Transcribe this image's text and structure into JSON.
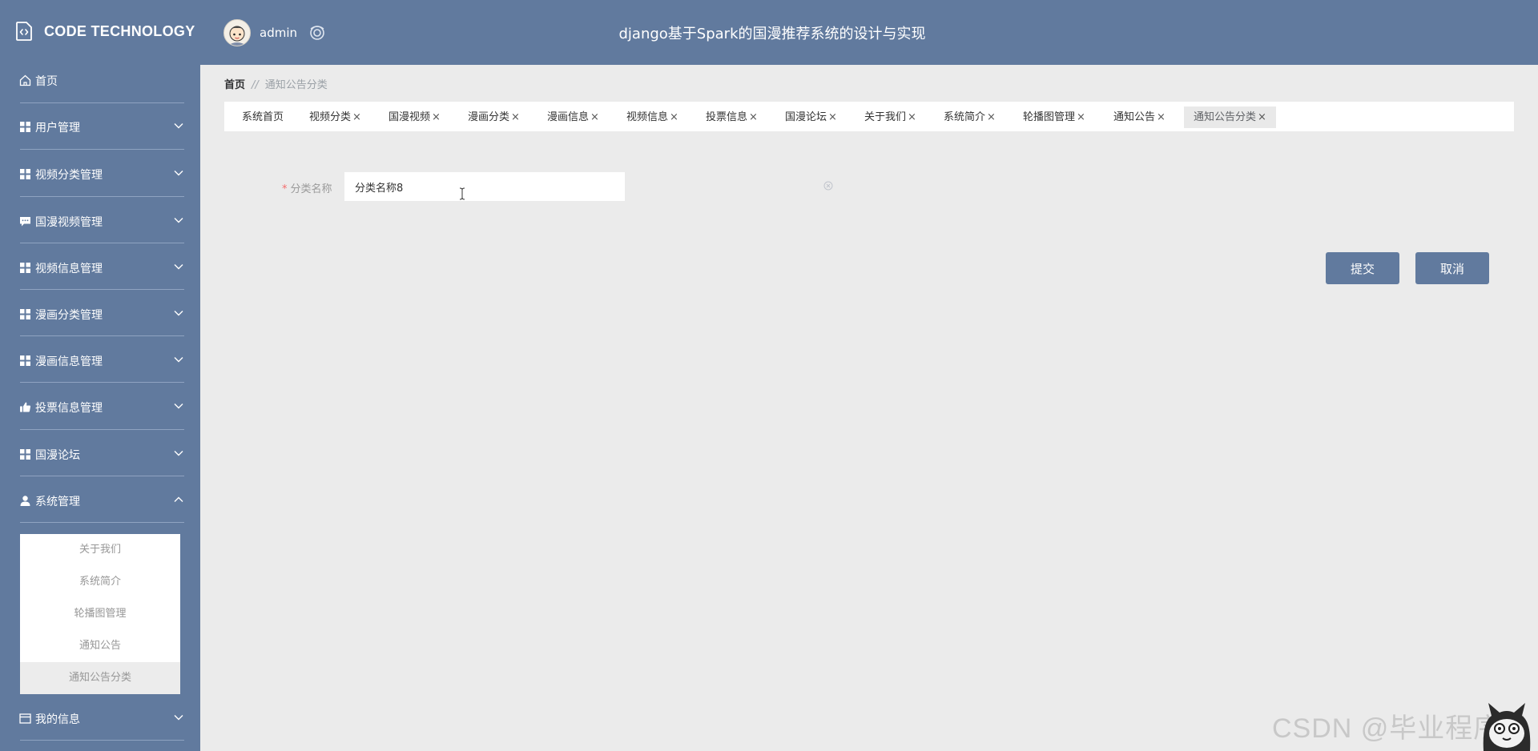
{
  "header": {
    "logo_text": "CODE TECHNOLOGY",
    "username": "admin",
    "app_title": "django基于Spark的国漫推荐系统的设计与实现"
  },
  "sidebar": {
    "items": [
      {
        "label": "首页",
        "icon": "home-icon"
      },
      {
        "label": "用户管理",
        "icon": "grid-icon"
      },
      {
        "label": "视频分类管理",
        "icon": "grid-icon"
      },
      {
        "label": "国漫视频管理",
        "icon": "chat-icon"
      },
      {
        "label": "视频信息管理",
        "icon": "grid-icon"
      },
      {
        "label": "漫画分类管理",
        "icon": "grid-icon"
      },
      {
        "label": "漫画信息管理",
        "icon": "grid-icon"
      },
      {
        "label": "投票信息管理",
        "icon": "thumb-up-icon"
      },
      {
        "label": "国漫论坛",
        "icon": "grid-icon"
      },
      {
        "label": "系统管理",
        "icon": "user-icon"
      },
      {
        "label": "我的信息",
        "icon": "card-icon"
      }
    ],
    "submenu": [
      "关于我们",
      "系统简介",
      "轮播图管理",
      "通知公告",
      "通知公告分类"
    ],
    "active_sub": "通知公告分类"
  },
  "breadcrumb": {
    "home": "首页",
    "separator": "//",
    "current": "通知公告分类"
  },
  "tabs": [
    "系统首页",
    "视频分类",
    "国漫视频",
    "漫画分类",
    "漫画信息",
    "视频信息",
    "投票信息",
    "国漫论坛",
    "关于我们",
    "系统简介",
    "轮播图管理",
    "通知公告",
    "通知公告分类"
  ],
  "tab_close": "×",
  "active_tab": "通知公告分类",
  "form": {
    "required_mark": "*",
    "label": "分类名称",
    "value": "分类名称8"
  },
  "buttons": {
    "submit": "提交",
    "cancel": "取消"
  },
  "watermark": "CSDN @毕业程序员",
  "colors": {
    "primary": "#617a9e",
    "background": "#ebebeb",
    "required": "#f56c6c"
  }
}
